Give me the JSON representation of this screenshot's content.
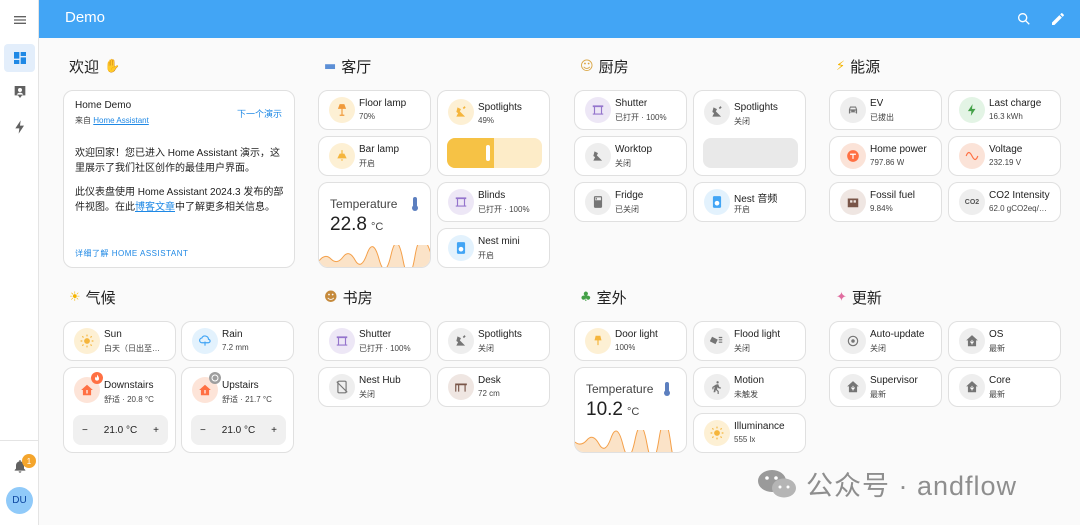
{
  "app": {
    "title": "Demo"
  },
  "sidebar": {
    "notification_count": "1",
    "user_initials": "DU"
  },
  "sections": {
    "welcome": "欢迎",
    "living": "客厅",
    "kitchen": "厨房",
    "energy": "能源",
    "weather": "气候",
    "study": "书房",
    "outdoor": "室外",
    "updates": "更新"
  },
  "welcome": {
    "title": "Home Demo",
    "source_prefix": "来自",
    "source_link": "Home Assistant",
    "next_demo": "下一个演示",
    "para1": "欢迎回家！您已进入 Home Assistant 演示，这里展示了我们社区创作的最佳用户界面。",
    "para2_a": "此仪表盘使用 Home Assistant 2024.3 发布的部件视图。在此",
    "para2_link": "博客文章",
    "para2_b": "中了解更多相关信息。",
    "learn_more": "详细了解 HOME ASSISTANT"
  },
  "living": {
    "floor_lamp": {
      "name": "Floor lamp",
      "state": "70%"
    },
    "bar_lamp": {
      "name": "Bar lamp",
      "state": "开启"
    },
    "spotlights": {
      "name": "Spotlights",
      "state": "49%",
      "brightness": 0.49
    },
    "temperature": {
      "name": "Temperature",
      "value": "22.8",
      "unit": "°C"
    },
    "blinds": {
      "name": "Blinds",
      "state": "已打开 · 100%"
    },
    "nest_mini": {
      "name": "Nest mini",
      "state": "开启"
    }
  },
  "kitchen": {
    "shutter": {
      "name": "Shutter",
      "state": "已打开 · 100%"
    },
    "spotlights": {
      "name": "Spotlights",
      "state": "关闭"
    },
    "worktop": {
      "name": "Worktop",
      "state": "关闭"
    },
    "fridge": {
      "name": "Fridge",
      "state": "已关闭"
    },
    "nest_audio": {
      "name": "Nest 音频",
      "state": "开启"
    }
  },
  "energy": {
    "ev": {
      "name": "EV",
      "state": "已拔出"
    },
    "last_charge": {
      "name": "Last charge",
      "state": "16.3 kWh"
    },
    "home_power": {
      "name": "Home power",
      "state": "797.86 W"
    },
    "voltage": {
      "name": "Voltage",
      "state": "232.19 V"
    },
    "fossil_fuel": {
      "name": "Fossil fuel",
      "state": "9.84%"
    },
    "co2": {
      "name": "CO2 Intensity",
      "state": "62.0 gCO2eq/…",
      "icon_text": "CO2"
    }
  },
  "weather": {
    "sun": {
      "name": "Sun",
      "state": "白天（日出至…"
    },
    "rain": {
      "name": "Rain",
      "state": "7.2 mm"
    },
    "downstairs": {
      "name": "Downstairs",
      "state": "舒适 · 20.8 °C",
      "setpoint": "21.0 °C"
    },
    "upstairs": {
      "name": "Upstairs",
      "state": "舒适 · 21.7 °C",
      "setpoint": "21.0 °C"
    },
    "minus": "−",
    "plus": "+"
  },
  "study": {
    "shutter": {
      "name": "Shutter",
      "state": "已打开 · 100%"
    },
    "spotlights": {
      "name": "Spotlights",
      "state": "关闭"
    },
    "nest_hub": {
      "name": "Nest Hub",
      "state": "关闭"
    },
    "desk": {
      "name": "Desk",
      "state": "72 cm"
    }
  },
  "outdoor": {
    "door_light": {
      "name": "Door light",
      "state": "100%"
    },
    "flood_light": {
      "name": "Flood light",
      "state": "关闭"
    },
    "temperature": {
      "name": "Temperature",
      "value": "10.2",
      "unit": "°C"
    },
    "motion": {
      "name": "Motion",
      "state": "未触发"
    },
    "illuminance": {
      "name": "Illuminance",
      "state": "555 lx"
    }
  },
  "updates": {
    "auto_update": {
      "name": "Auto-update",
      "state": "关闭"
    },
    "os": {
      "name": "OS",
      "state": "最新"
    },
    "supervisor": {
      "name": "Supervisor",
      "state": "最新"
    },
    "core": {
      "name": "Core",
      "state": "最新"
    }
  },
  "watermark": "公众号 · andflow",
  "colors": {
    "primary": "#42a5f5",
    "amber": "#f6c245",
    "orange": "#ff7043",
    "purple": "#9575cd",
    "grey": "#757575",
    "green": "#43a047",
    "brown": "#795548"
  }
}
